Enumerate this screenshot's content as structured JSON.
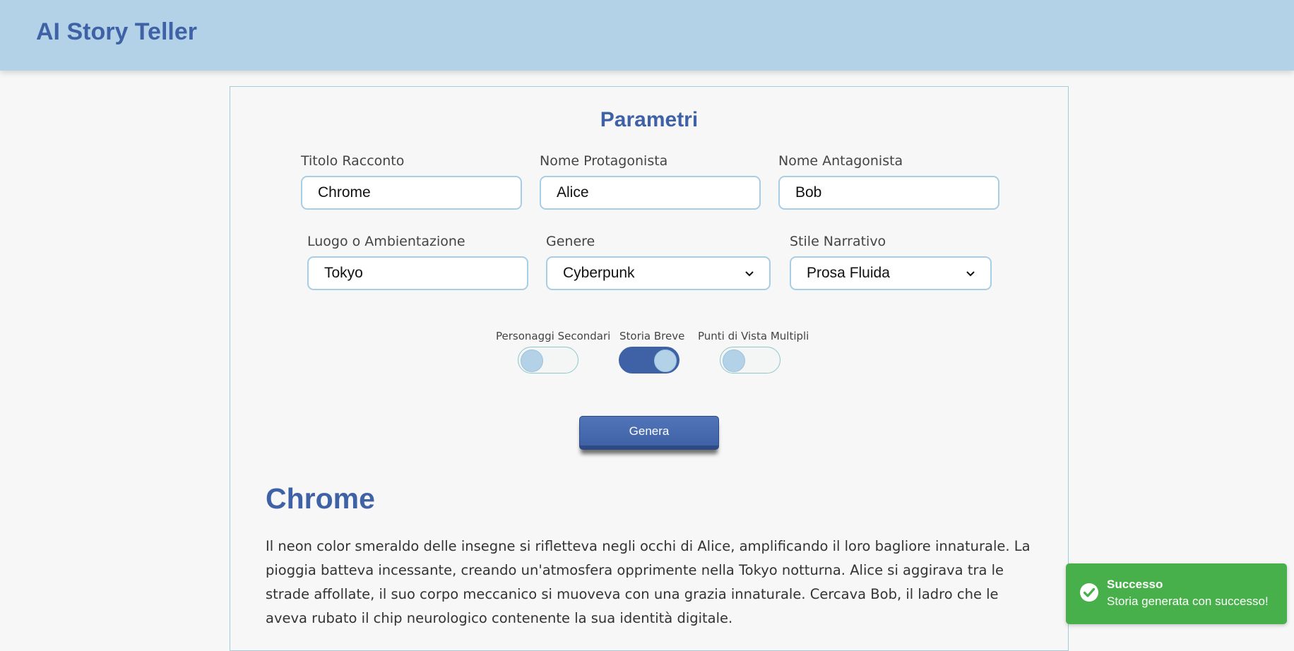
{
  "app": {
    "title": "AI Story Teller"
  },
  "form": {
    "section_title": "Parametri",
    "fields": {
      "titolo": {
        "label": "Titolo Racconto",
        "value": "Chrome"
      },
      "protagonista": {
        "label": "Nome Protagonista",
        "value": "Alice"
      },
      "antagonista": {
        "label": "Nome Antagonista",
        "value": "Bob"
      },
      "luogo": {
        "label": "Luogo o Ambientazione",
        "value": "Tokyo"
      },
      "genere": {
        "label": "Genere",
        "value": "Cyberpunk"
      },
      "stile": {
        "label": "Stile Narrativo",
        "value": "Prosa Fluida"
      }
    },
    "toggles": [
      {
        "label": "Personaggi Secondari",
        "on": false
      },
      {
        "label": "Storia Breve",
        "on": true
      },
      {
        "label": "Punti di Vista Multipli",
        "on": false
      }
    ],
    "generate_label": "Genera"
  },
  "story": {
    "title": "Chrome",
    "text": "Il neon color smeraldo delle insegne si rifletteva negli occhi di Alice, amplificando il loro bagliore innaturale. La pioggia batteva incessante, creando un'atmosfera opprimente nella Tokyo notturna. Alice si aggirava tra le strade affollate, il suo corpo meccanico si muoveva con una grazia innaturale. Cercava Bob, il ladro che le aveva rubato il chip neurologico contenente la sua identità digitale."
  },
  "toast": {
    "title": "Successo",
    "message": "Storia generata con successo!",
    "icon": "check-circle-icon",
    "color": "#48b04a"
  },
  "colors": {
    "accent": "#3f62a6",
    "header": "#b3d2e8"
  }
}
